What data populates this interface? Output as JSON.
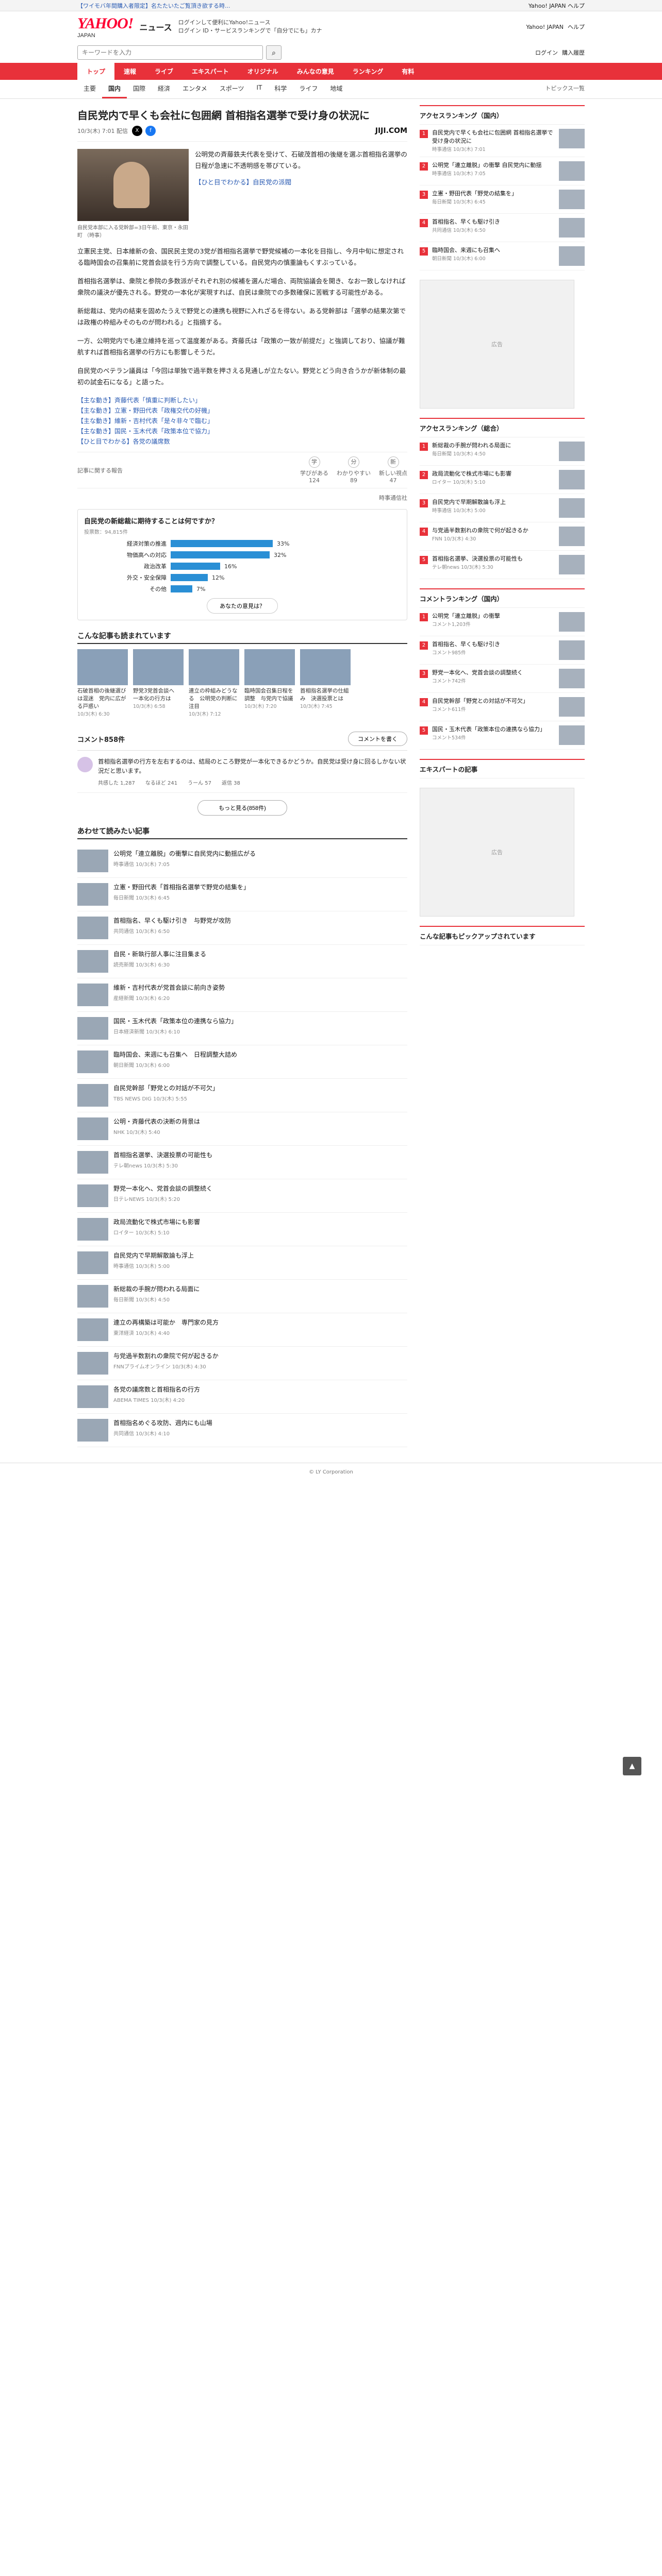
{
  "topbar": {
    "notice": "【ワイモバ年間購入者限定】名たたいたご覧頂き欲する時...",
    "right": "Yahoo! JAPAN ヘルプ"
  },
  "header": {
    "logo": "YAHOO!",
    "logo_sub": "JAPAN",
    "section": "ニュース",
    "links": [
      "ログインして便利にYahoo!ニュース",
      "ログイン ID・サービスランキングで「自分でにも」カナ"
    ],
    "right": [
      "Yahoo! JAPAN",
      "ヘルプ"
    ]
  },
  "search": {
    "placeholder": "キーワードを入力",
    "right": [
      "ログイン",
      "購入履歴"
    ]
  },
  "nav1": [
    "トップ",
    "速報",
    "ライブ",
    "エキスパート",
    "オリジナル",
    "みんなの意見",
    "ランキング",
    "有料"
  ],
  "nav2": [
    "主要",
    "国内",
    "国際",
    "経済",
    "エンタメ",
    "スポーツ",
    "IT",
    "科学",
    "ライフ",
    "地域"
  ],
  "nav2_right": "トピックス一覧",
  "article": {
    "title": "自民党内で早くも会社に包囲網 首相指名選挙で受け身の状況に",
    "date": "10/3(木) 7:01 配信",
    "brand": "JIJI.COM",
    "photo_caption": "自民党本部に入る党幹部=3日午前、東京・永田町 （時事）",
    "lead": "公明党の斉藤鉄夫代表を受けて、石破茂首相の後継を選ぶ首相指名選挙の日程が急速に不透明感を帯びている。",
    "heading": "【ひと目でわかる】自民党の派閥",
    "paragraphs": [
      "立憲民主党、日本維新の会、国民民主党の3党が首相指名選挙で野党候補の一本化を目指し、今月中旬に想定される臨時国会の召集前に党首会談を行う方向で調整している。自民党内の慎重論もくすぶっている。",
      "首相指名選挙は、衆院と参院の多数派がそれぞれ別の候補を選んだ場合、両院協議会を開き、なお一致しなければ衆院の議決が優先される。野党の一本化が実現すれば、自民は衆院での多数確保に苦戦する可能性がある。",
      "新総裁は、党内の結束を固めたうえで野党との連携も視野に入れざるを得ない。ある党幹部は「選挙の結果次第では政権の枠組みそのものが問われる」と指摘する。",
      "一方、公明党内でも連立維持を巡って温度差がある。斉藤氏は「政策の一致が前提だ」と強調しており、協議が難航すれば首相指名選挙の行方にも影響しそうだ。",
      "自民党のベテラン議員は「今回は単独で過半数を押さえる見通しが立たない。野党とどう向き合うかが新体制の最初の試金石になる」と語った。"
    ],
    "highlight": "首相指名選挙",
    "related_links": [
      "【主な動き】斉藤代表「慎重に判断したい」",
      "【主な動き】立憲・野田代表「政権交代の好機」",
      "【主な動き】維新・吉村代表「是々非々で臨む」",
      "【主な動き】国民・玉木代表「政策本位で協力」",
      "【ひと目でわかる】各党の議席数"
    ],
    "reactions_label": "記事に関する報告",
    "reactions": [
      {
        "icon": "学",
        "label": "学びがある",
        "count": "124"
      },
      {
        "icon": "分",
        "label": "わかりやすい",
        "count": "89"
      },
      {
        "icon": "新",
        "label": "新しい視点",
        "count": "47"
      }
    ],
    "source": "時事通信社"
  },
  "poll": {
    "title": "自民党の新総裁に期待することは何ですか？",
    "sub": "投票数：94,815件",
    "options": [
      {
        "label": "経済対策の推進",
        "pct": 33
      },
      {
        "label": "物価高への対応",
        "pct": 32
      },
      {
        "label": "政治改革",
        "pct": 16
      },
      {
        "label": "外交・安全保障",
        "pct": 12
      },
      {
        "label": "その他",
        "pct": 7
      }
    ],
    "vote_label": "あなたの意見は？"
  },
  "also_read": {
    "heading": "こんな記事も読まれています",
    "cards": [
      {
        "t": "石破首相の後継選びは混迷　党内に広がる戸惑い",
        "src": "10/3(木) 6:30"
      },
      {
        "t": "野党3党首会談へ　一本化の行方は",
        "src": "10/3(木) 6:58"
      },
      {
        "t": "連立の枠組みどうなる　公明党の判断に注目",
        "src": "10/3(木) 7:12"
      },
      {
        "t": "臨時国会召集日程を調整　与党内で協議",
        "src": "10/3(木) 7:20"
      },
      {
        "t": "首相指名選挙の仕組み　決選投票とは",
        "src": "10/3(木) 7:45"
      }
    ]
  },
  "comments": {
    "count": "コメント858件",
    "write_label": "コメントを書く",
    "first": "首相指名選挙の行方を左右するのは、結局のところ野党が一本化できるかどうか。自民党は受け身に回るしかない状況だと思います。",
    "acts": [
      "共感した 1,287",
      "なるほど 241",
      "うーん 57",
      "返信 38"
    ],
    "more_label": "もっと見る(858件)"
  },
  "news_list": {
    "heading": "あわせて読みたい記事",
    "items": [
      {
        "t": "公明党「連立離脱」の衝撃に自民党内に動揺広がる",
        "s": "時事通信 10/3(木) 7:05"
      },
      {
        "t": "立憲・野田代表「首相指名選挙で野党の結集を」",
        "s": "毎日新聞 10/3(木) 6:45"
      },
      {
        "t": "首相指名、早くも駆け引き　与野党が攻防",
        "s": "共同通信 10/3(木) 6:50"
      },
      {
        "t": "自民・新執行部人事に注目集まる",
        "s": "読売新聞 10/3(木) 6:30"
      },
      {
        "t": "維新・吉村代表が党首会談に前向き姿勢",
        "s": "産経新聞 10/3(木) 6:20"
      },
      {
        "t": "国民・玉木代表「政策本位の連携なら協力」",
        "s": "日本経済新聞 10/3(木) 6:10"
      },
      {
        "t": "臨時国会、来週にも召集へ　日程調整大詰め",
        "s": "朝日新聞 10/3(木) 6:00"
      },
      {
        "t": "自民党幹部「野党との対話が不可欠」",
        "s": "TBS NEWS DIG 10/3(木) 5:55"
      },
      {
        "t": "公明・斉藤代表の決断の背景は",
        "s": "NHK 10/3(木) 5:40"
      },
      {
        "t": "首相指名選挙、決選投票の可能性も",
        "s": "テレ朝news 10/3(木) 5:30"
      },
      {
        "t": "野党一本化へ、党首会談の調整続く",
        "s": "日テレNEWS 10/3(木) 5:20"
      },
      {
        "t": "政局流動化で株式市場にも影響",
        "s": "ロイター 10/3(木) 5:10"
      },
      {
        "t": "自民党内で早期解散論も浮上",
        "s": "時事通信 10/3(木) 5:00"
      },
      {
        "t": "新総裁の手腕が問われる局面に",
        "s": "毎日新聞 10/3(木) 4:50"
      },
      {
        "t": "連立の再構築は可能か　専門家の見方",
        "s": "東洋経済 10/3(木) 4:40"
      },
      {
        "t": "与党過半数割れの衆院で何が起きるか",
        "s": "FNNプライムオンライン 10/3(木) 4:30"
      },
      {
        "t": "各党の議席数と首相指名の行方",
        "s": "ABEMA TIMES 10/3(木) 4:20"
      },
      {
        "t": "首相指名めぐる攻防、週内にも山場",
        "s": "共同通信 10/3(木) 4:10"
      }
    ]
  },
  "sidebar": {
    "ranking_title": "アクセスランキング（国内）",
    "ranking": [
      {
        "t": "自民党内で早くも会社に包囲網 首相指名選挙で受け身の状況に",
        "s": "時事通信 10/3(木) 7:01"
      },
      {
        "t": "公明党「連立離脱」の衝撃 自民党内に動揺",
        "s": "時事通信 10/3(木) 7:05"
      },
      {
        "t": "立憲・野田代表「野党の結集を」",
        "s": "毎日新聞 10/3(木) 6:45"
      },
      {
        "t": "首相指名、早くも駆け引き",
        "s": "共同通信 10/3(木) 6:50"
      },
      {
        "t": "臨時国会、来週にも召集へ",
        "s": "朝日新聞 10/3(木) 6:00"
      }
    ],
    "ranking2_title": "アクセスランキング（総合）",
    "ranking2": [
      {
        "t": "新総裁の手腕が問われる局面に",
        "s": "毎日新聞 10/3(木) 4:50"
      },
      {
        "t": "政局流動化で株式市場にも影響",
        "s": "ロイター 10/3(木) 5:10"
      },
      {
        "t": "自民党内で早期解散論も浮上",
        "s": "時事通信 10/3(木) 5:00"
      },
      {
        "t": "与党過半数割れの衆院で何が起きるか",
        "s": "FNN 10/3(木) 4:30"
      },
      {
        "t": "首相指名選挙、決選投票の可能性も",
        "s": "テレ朝news 10/3(木) 5:30"
      }
    ],
    "comment_rank_title": "コメントランキング（国内）",
    "comment_rank": [
      {
        "t": "公明党「連立離脱」の衝撃",
        "s": "コメント1,203件"
      },
      {
        "t": "首相指名、早くも駆け引き",
        "s": "コメント985件"
      },
      {
        "t": "野党一本化へ、党首会談の調整続く",
        "s": "コメント742件"
      },
      {
        "t": "自民党幹部「野党との対話が不可欠」",
        "s": "コメント611件"
      },
      {
        "t": "国民・玉木代表「政策本位の連携なら協力」",
        "s": "コメント534件"
      }
    ],
    "ad_label": "広告",
    "expert_title": "エキスパートの記事",
    "pickup_title": "こんな記事もピックアップされています"
  },
  "page_top": "▲",
  "footer": "© LY Corporation"
}
